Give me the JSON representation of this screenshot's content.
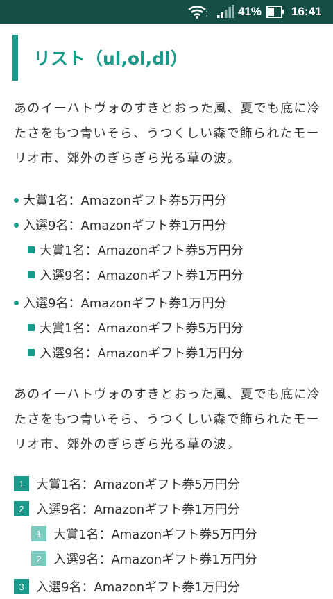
{
  "status_bar": {
    "battery_percent": "41%",
    "time": "16:41",
    "icons": [
      "wifi-icon",
      "signal-icon",
      "battery-icon"
    ]
  },
  "article": {
    "heading": "リスト（ul,ol,dl）",
    "paragraph_1": "あのイーハトヴォのすきとおった風、夏でも底に冷たさをもつ青いそら、うつくしい森で飾られたモーリオ市、郊外のぎらぎら光る草の波。",
    "ul_items": [
      "大賞1名：Amazonギフト券5万円分",
      "入選9名：Amazonギフト券1万円分",
      "大賞1名：Amazonギフト券5万円分",
      "入選9名：Amazonギフト券1万円分",
      "入選9名：Amazonギフト券1万円分",
      "大賞1名：Amazonギフト券5万円分",
      "入選9名：Amazonギフト券1万円分"
    ],
    "paragraph_2": "あのイーハトヴォのすきとおった風、夏でも底に冷たさをもつ青いそら、うつくしい森で飾られたモーリオ市、郊外のぎらぎら光る草の波。",
    "ol_items": [
      {
        "num": "1",
        "text": "大賞1名：Amazonギフト券5万円分"
      },
      {
        "num": "2",
        "text": "入選9名：Amazonギフト券1万円分"
      },
      {
        "num": "1",
        "text": "大賞1名：Amazonギフト券5万円分"
      },
      {
        "num": "2",
        "text": "入選9名：Amazonギフト券1万円分"
      },
      {
        "num": "3",
        "text": "入選9名：Amazonギフト券1万円分"
      }
    ]
  },
  "colors": {
    "status_bar": "#134d44",
    "accent": "#1a9a8a",
    "accent_light": "#7ccbc1",
    "text": "#333333"
  }
}
